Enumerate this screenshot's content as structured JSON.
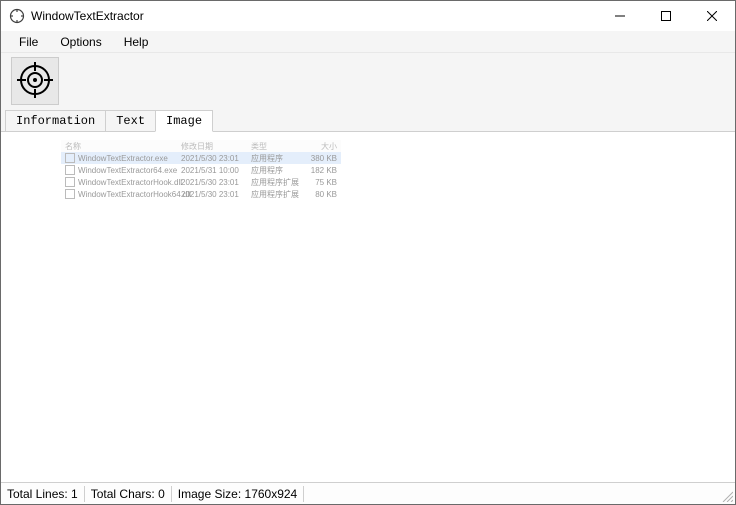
{
  "window": {
    "title": "WindowTextExtractor"
  },
  "menu": {
    "file": "File",
    "options": "Options",
    "help": "Help"
  },
  "tabs": {
    "information": "Information",
    "text": "Text",
    "image": "Image",
    "active": "image"
  },
  "captured": {
    "headers": {
      "name": "名称",
      "date": "修改日期",
      "type": "类型",
      "size": "大小"
    },
    "rows": [
      {
        "name": "WindowTextExtractor.exe",
        "date": "2021/5/30 23:01",
        "type": "应用程序",
        "size": "380 KB",
        "selected": true
      },
      {
        "name": "WindowTextExtractor64.exe",
        "date": "2021/5/31 10:00",
        "type": "应用程序",
        "size": "182 KB",
        "selected": false
      },
      {
        "name": "WindowTextExtractorHook.dll",
        "date": "2021/5/30 23:01",
        "type": "应用程序扩展",
        "size": "75 KB",
        "selected": false
      },
      {
        "name": "WindowTextExtractorHook64.dll",
        "date": "2021/5/30 23:01",
        "type": "应用程序扩展",
        "size": "80 KB",
        "selected": false
      }
    ]
  },
  "status": {
    "total_lines_label": "Total Lines:",
    "total_lines_value": "1",
    "total_chars_label": "Total Chars:",
    "total_chars_value": "0",
    "image_size_label": "Image Size:",
    "image_size_value": "1760x924"
  }
}
